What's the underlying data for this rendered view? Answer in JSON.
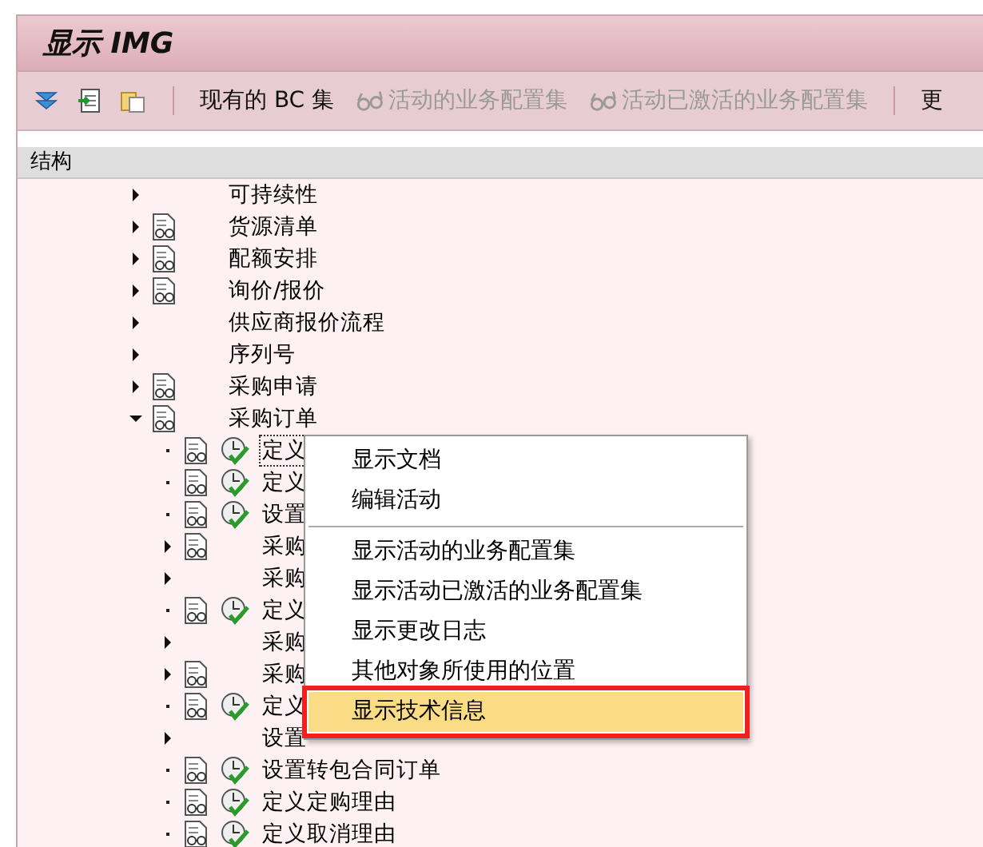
{
  "window": {
    "title": "显示 IMG"
  },
  "toolbar": {
    "icon_buttons": [
      {
        "kind": "expand"
      },
      {
        "kind": "import"
      },
      {
        "kind": "paste"
      }
    ],
    "buttons": [
      {
        "label": "现有的 BC 集",
        "disabled": false,
        "glasses": false
      },
      {
        "label": "活动的业务配置集",
        "disabled": true,
        "glasses": true
      },
      {
        "label": "活动已激活的业务配置集",
        "disabled": true,
        "glasses": true
      },
      {
        "label": "更",
        "disabled": false,
        "glasses": false
      }
    ]
  },
  "tree": {
    "header": "结构",
    "items": [
      {
        "label": "可持续性",
        "kind": "folder",
        "expanded": false,
        "doc": false
      },
      {
        "label": "货源清单",
        "kind": "folder",
        "expanded": false,
        "doc": true
      },
      {
        "label": "配额安排",
        "kind": "folder",
        "expanded": false,
        "doc": true
      },
      {
        "label": "询价/报价",
        "kind": "folder",
        "expanded": false,
        "doc": true
      },
      {
        "label": "供应商报价流程",
        "kind": "folder",
        "expanded": false,
        "doc": false
      },
      {
        "label": "序列号",
        "kind": "folder",
        "expanded": false,
        "doc": false
      },
      {
        "label": "采购申请",
        "kind": "folder",
        "expanded": false,
        "doc": true
      },
      {
        "label": "采购订单",
        "kind": "folder",
        "expanded": true,
        "doc": true,
        "children": [
          {
            "label": "定义",
            "kind": "activity",
            "doc": true,
            "activity": true,
            "focused": true
          },
          {
            "label": "定义",
            "kind": "activity",
            "doc": true,
            "activity": true,
            "focused": false
          },
          {
            "label": "设置",
            "kind": "activity",
            "doc": true,
            "activity": true,
            "focused": false
          },
          {
            "label": "采购",
            "kind": "folder",
            "expanded": false,
            "doc": true,
            "activity": false,
            "focused": false
          },
          {
            "label": "采购",
            "kind": "folder",
            "expanded": false,
            "doc": false,
            "activity": false,
            "focused": false
          },
          {
            "label": "定义",
            "kind": "activity",
            "doc": true,
            "activity": true,
            "focused": false
          },
          {
            "label": "采购",
            "kind": "folder",
            "expanded": false,
            "doc": false,
            "activity": false,
            "focused": false
          },
          {
            "label": "采购",
            "kind": "folder",
            "expanded": false,
            "doc": true,
            "activity": false,
            "focused": false
          },
          {
            "label": "定义",
            "kind": "activity",
            "doc": true,
            "activity": true,
            "focused": false
          },
          {
            "label": "设置",
            "kind": "folder",
            "expanded": false,
            "doc": false,
            "activity": false,
            "focused": false
          },
          {
            "label": "设置转包合同订单",
            "kind": "activity",
            "doc": true,
            "activity": true,
            "focused": false
          },
          {
            "label": "定义定购理由",
            "kind": "activity",
            "doc": true,
            "activity": true,
            "focused": false
          },
          {
            "label": "定义取消理由",
            "kind": "activity",
            "doc": true,
            "activity": true,
            "focused": false
          }
        ]
      }
    ]
  },
  "context_menu": {
    "groups": [
      [
        {
          "label": "显示文档",
          "selected": false
        },
        {
          "label": "编辑活动",
          "selected": false
        }
      ],
      [
        {
          "label": "显示活动的业务配置集",
          "selected": false
        },
        {
          "label": "显示活动已激活的业务配置集",
          "selected": false
        },
        {
          "label": "显示更改日志",
          "selected": false
        },
        {
          "label": "其他对象所使用的位置",
          "selected": false
        },
        {
          "label": "显示技术信息",
          "selected": true,
          "outlined": true
        }
      ]
    ]
  }
}
